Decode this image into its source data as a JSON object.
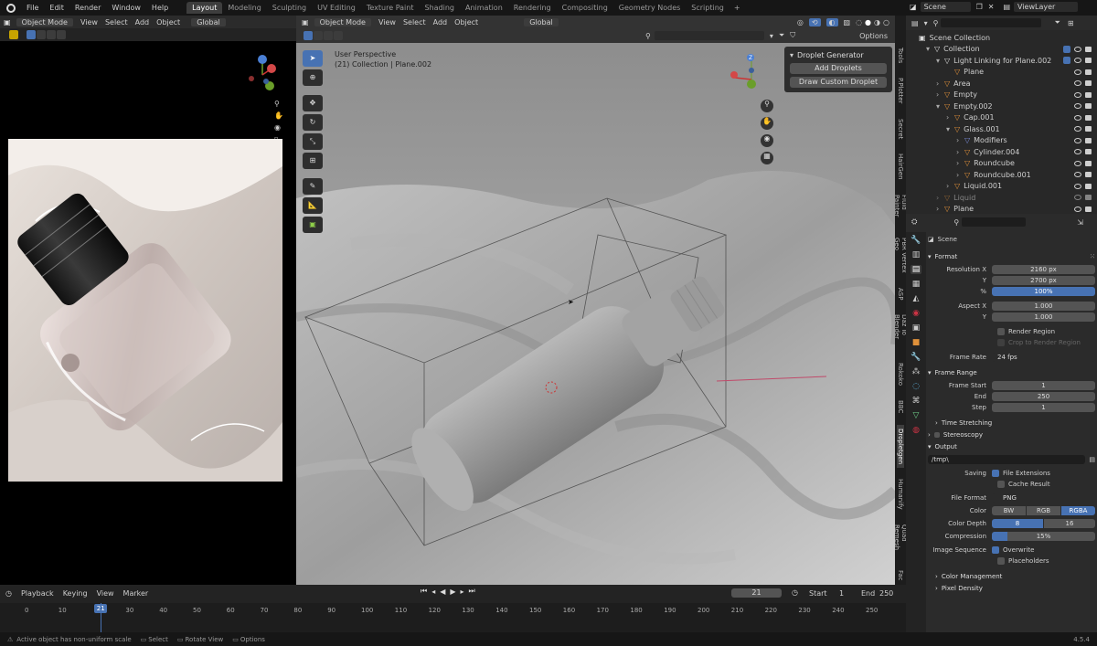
{
  "menu": {
    "items": [
      "File",
      "Edit",
      "Render",
      "Window",
      "Help"
    ]
  },
  "workspace_tabs": [
    "Layout",
    "Modeling",
    "Sculpting",
    "UV Editing",
    "Texture Paint",
    "Shading",
    "Animation",
    "Rendering",
    "Compositing",
    "Geometry Nodes",
    "Scripting"
  ],
  "add_tab": "+",
  "scene": {
    "name": "Scene",
    "view_layer": "ViewLayer"
  },
  "left_header": {
    "mode": "Object Mode",
    "menus": [
      "View",
      "Select",
      "Add",
      "Object"
    ],
    "orientation": "Global"
  },
  "viewport": {
    "mode": "Object Mode",
    "menus": [
      "View",
      "Select",
      "Add",
      "Object"
    ],
    "orientation": "Global",
    "perspective": "User Perspective",
    "collection_info": "(21) Collection | Plane.002",
    "options": "Options"
  },
  "droplet": {
    "title": "Droplet Generator",
    "add": "Add Droplets",
    "draw": "Draw Custom Droplet"
  },
  "side_tabs": [
    "Tools",
    "P.Plotter",
    "Secret",
    "HairGen",
    "Fluid Painter",
    "PBR Vertex Geo",
    "ASP",
    "Daz To Blender",
    "Rokoko",
    "BBC",
    "Dropletgen",
    "Humanify",
    "Quad Remesh",
    "Fac"
  ],
  "outliner": {
    "root": "Scene Collection",
    "items": [
      {
        "name": "Collection",
        "depth": 0,
        "arrow": "▾",
        "icon": "#e0e0e0",
        "checkbox": true
      },
      {
        "name": "Light Linking for Plane.002",
        "depth": 1,
        "arrow": "▾",
        "icon": "#e0e0e0",
        "checkbox": true
      },
      {
        "name": "Plane",
        "depth": 2,
        "arrow": "",
        "icon": "#e0913a"
      },
      {
        "name": "Area",
        "depth": 1,
        "arrow": "›",
        "icon": "#e0913a"
      },
      {
        "name": "Empty",
        "depth": 1,
        "arrow": "›",
        "icon": "#e0913a"
      },
      {
        "name": "Empty.002",
        "depth": 1,
        "arrow": "▾",
        "icon": "#e0913a"
      },
      {
        "name": "Cap.001",
        "depth": 2,
        "arrow": "›",
        "icon": "#e0913a"
      },
      {
        "name": "Glass.001",
        "depth": 2,
        "arrow": "▾",
        "icon": "#e0913a"
      },
      {
        "name": "Modifiers",
        "depth": 3,
        "arrow": "›",
        "icon": "#7a8cd8"
      },
      {
        "name": "Cylinder.004",
        "depth": 3,
        "arrow": "›",
        "icon": "#e0913a"
      },
      {
        "name": "Roundcube",
        "depth": 3,
        "arrow": "›",
        "icon": "#e0913a"
      },
      {
        "name": "Roundcube.001",
        "depth": 3,
        "arrow": "›",
        "icon": "#e0913a"
      },
      {
        "name": "Liquid.001",
        "depth": 2,
        "arrow": "›",
        "icon": "#e0913a"
      },
      {
        "name": "Liquid",
        "depth": 1,
        "arrow": "›",
        "icon": "#e0913a",
        "dim": true
      },
      {
        "name": "Plane",
        "depth": 1,
        "arrow": "›",
        "icon": "#e0913a"
      }
    ]
  },
  "properties": {
    "context": "Scene",
    "format_title": "Format",
    "resolution_x_label": "Resolution X",
    "resolution_x": "2160 px",
    "y_label": "Y",
    "resolution_y": "2700 px",
    "pct_label": "%",
    "resolution_pct": "100%",
    "resolution_pct_fill": 1.0,
    "aspect_x_label": "Aspect X",
    "aspect_x": "1.000",
    "aspect_y": "1.000",
    "render_region": "Render Region",
    "crop_region": "Crop to Render Region",
    "frame_rate_label": "Frame Rate",
    "frame_rate": "24 fps",
    "frame_range_title": "Frame Range",
    "frame_start_label": "Frame Start",
    "frame_start": "1",
    "end_label": "End",
    "frame_end": "250",
    "step_label": "Step",
    "frame_step": "1",
    "time_stretching": "Time Stretching",
    "stereoscopy": "Stereoscopy",
    "output_title": "Output",
    "output_path": "/tmp\\",
    "saving_label": "Saving",
    "file_extensions": "File Extensions",
    "cache_result": "Cache Result",
    "file_format_label": "File Format",
    "file_format": "PNG",
    "color_label": "Color",
    "color_bw": "BW",
    "color_rgb": "RGB",
    "color_rgba": "RGBA",
    "color_depth_label": "Color Depth",
    "depth_8": "8",
    "depth_16": "16",
    "compression_label": "Compression",
    "compression": "15%",
    "compression_fill": 0.15,
    "image_sequence_label": "Image Sequence",
    "overwrite": "Overwrite",
    "placeholders": "Placeholders",
    "color_management": "Color Management",
    "pixel_density": "Pixel Density"
  },
  "timeline": {
    "menus": [
      "Playback",
      "Keying",
      "View",
      "Marker"
    ],
    "current_frame": "21",
    "start_label": "Start",
    "start": "1",
    "end_label": "End",
    "end": "250",
    "ticks": [
      "0",
      "10",
      "20",
      "30",
      "40",
      "50",
      "60",
      "70",
      "80",
      "90",
      "100",
      "110",
      "120",
      "130",
      "140",
      "150",
      "160",
      "170",
      "180",
      "190",
      "200",
      "210",
      "220",
      "230",
      "240",
      "250"
    ],
    "marker": "21"
  },
  "status": {
    "message": "Active object has non-uniform scale",
    "select": "Select",
    "rotate": "Rotate View",
    "options": "Options",
    "version": "4.5.4"
  },
  "colors": {
    "accent": "#4772b3",
    "active_tab": "#3d3d3d",
    "viewport_bg": "#a8a8a8",
    "timeline_marker": "#4772b3"
  }
}
